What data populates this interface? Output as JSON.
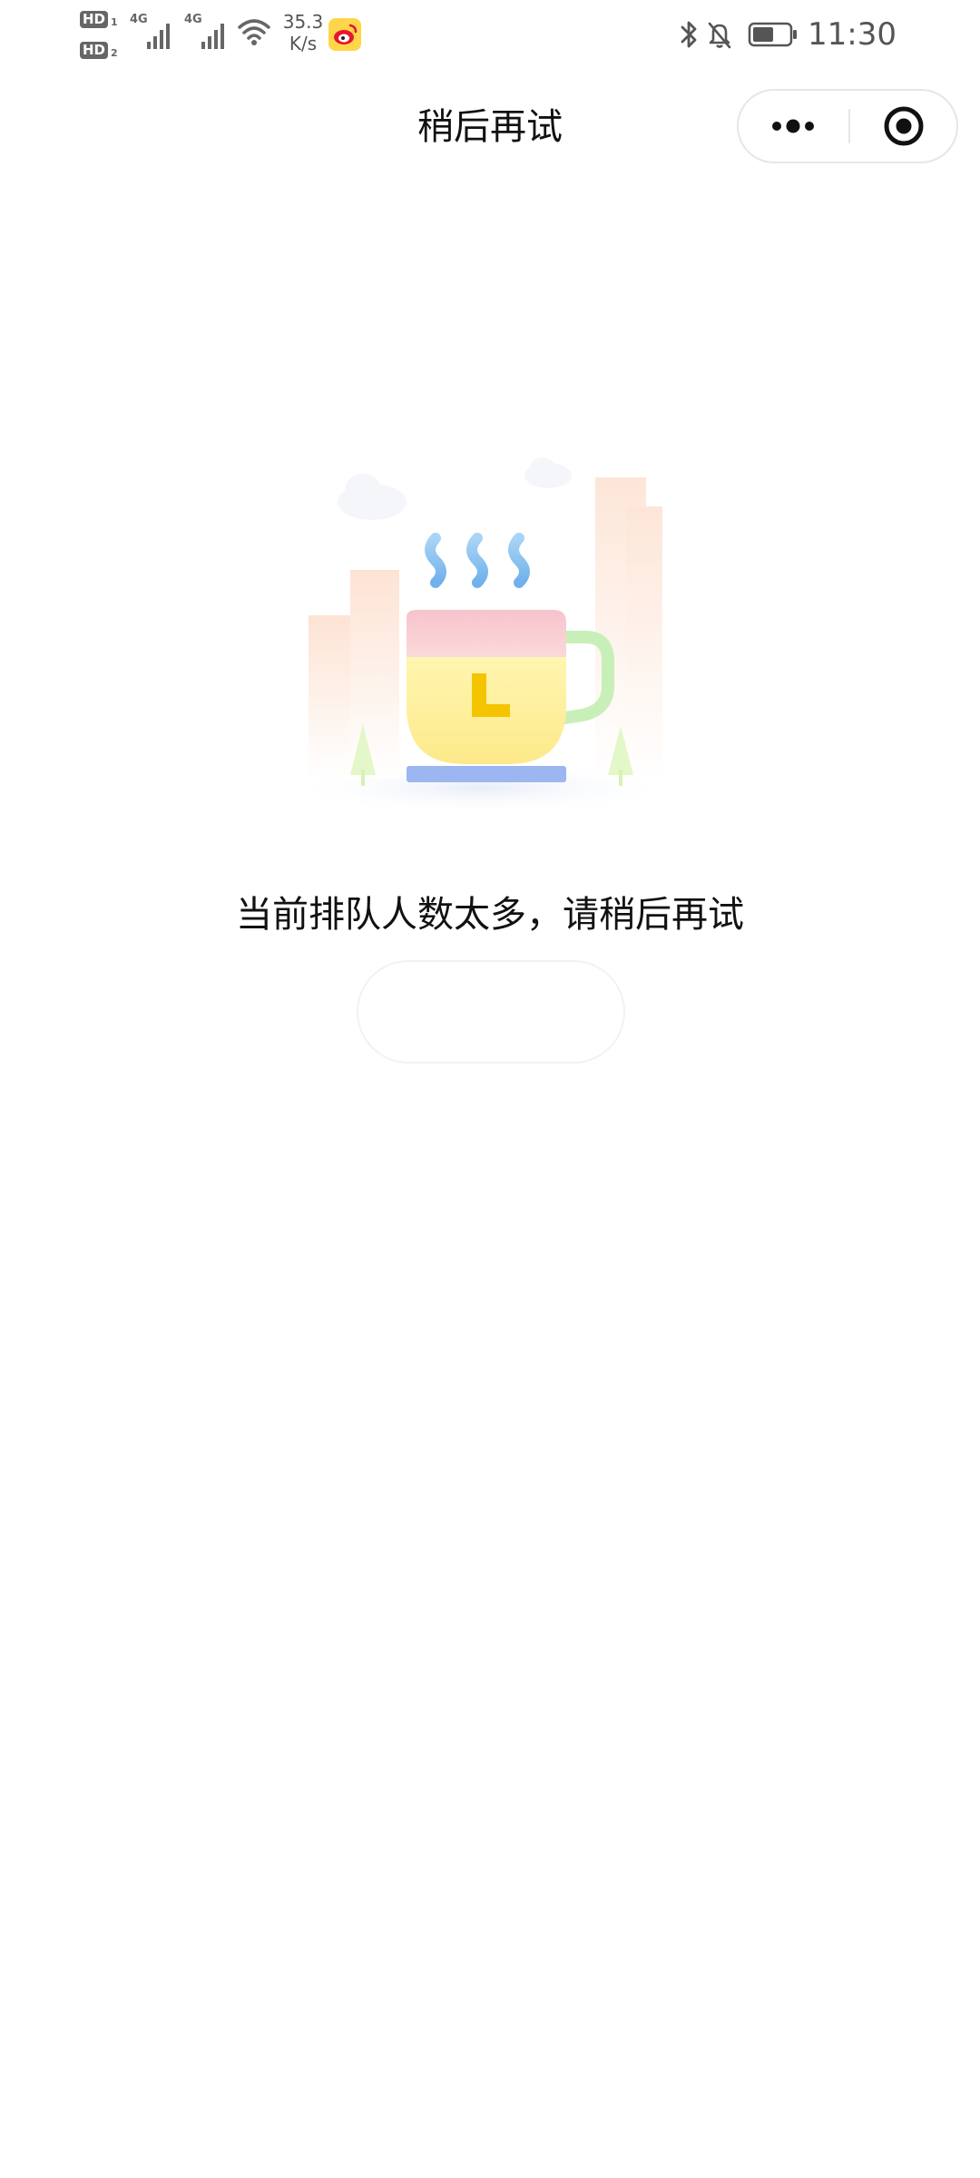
{
  "status_bar": {
    "sim1_badge": "HD",
    "sim2_badge": "HD",
    "sim1_index": "1",
    "sim2_index": "2",
    "network1": "4G",
    "network2": "4G",
    "speed_value": "35.3",
    "speed_unit": "K/s",
    "time": "11:30",
    "icons": [
      "signal-icon",
      "wifi-icon",
      "weibo-app-icon",
      "bluetooth-icon",
      "mute-bell-icon",
      "battery-icon"
    ]
  },
  "nav": {
    "title": "稍后再试",
    "more_icon": "more-dots-icon",
    "close_icon": "target-close-icon"
  },
  "main": {
    "illustration": "coffee-cup-with-clock-illustration",
    "message": "当前排队人数太多，请稍后再试",
    "retry_button_label": ""
  },
  "colors": {
    "background": "#ffffff",
    "text": "#111111",
    "cup_body": "#fff1a8",
    "cup_top": "#f7c6cf",
    "cup_handle": "#c9efb8",
    "clock_hands": "#f5c400",
    "saucer": "#9bb6f0",
    "steam": "#8cc4f2"
  }
}
